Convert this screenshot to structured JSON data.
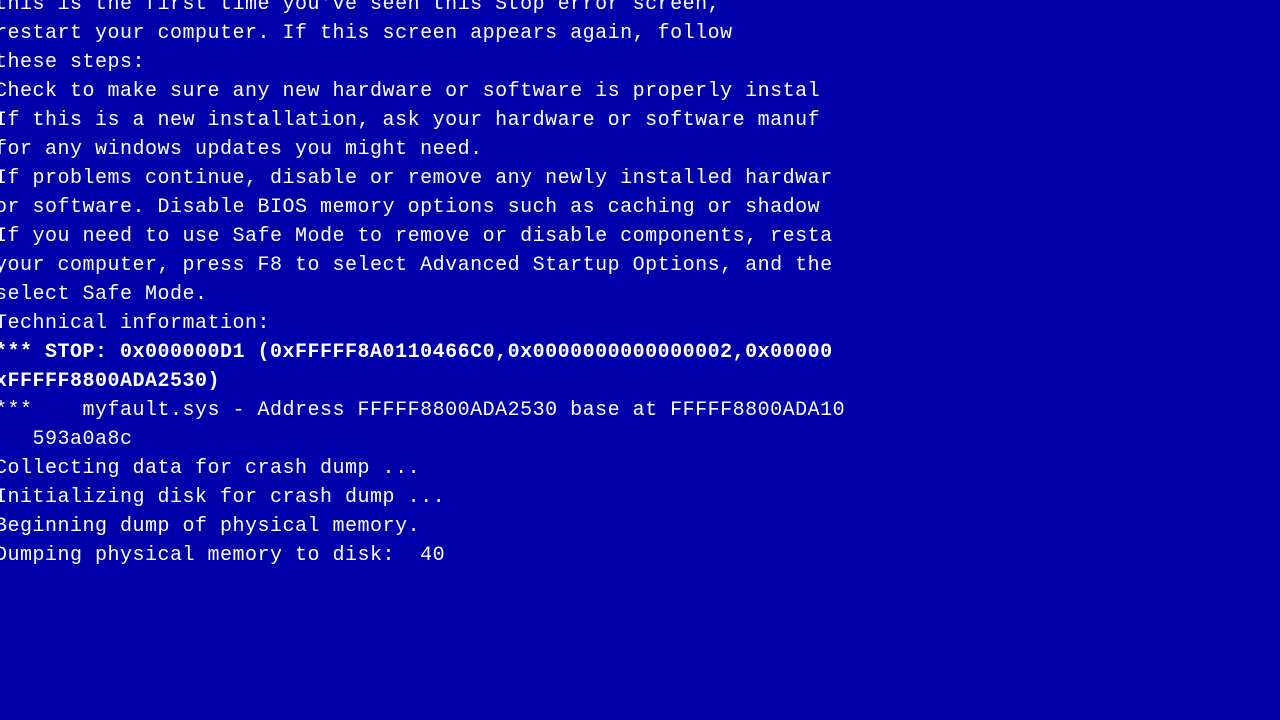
{
  "bsod": {
    "lines": [
      {
        "text": "",
        "bold": false
      },
      {
        "text": "this is the first time you've seen this Stop error screen,",
        "bold": false
      },
      {
        "text": "restart your computer. If this screen appears again, follow",
        "bold": false
      },
      {
        "text": "these steps:",
        "bold": false
      },
      {
        "text": "",
        "bold": false
      },
      {
        "text": "Check to make sure any new hardware or software is properly instal",
        "bold": false
      },
      {
        "text": "If this is a new installation, ask your hardware or software manuf",
        "bold": false
      },
      {
        "text": "for any windows updates you might need.",
        "bold": false
      },
      {
        "text": "",
        "bold": false
      },
      {
        "text": "If problems continue, disable or remove any newly installed hardwar",
        "bold": false
      },
      {
        "text": "or software. Disable BIOS memory options such as caching or shadow",
        "bold": false
      },
      {
        "text": "If you need to use Safe Mode to remove or disable components, resta",
        "bold": false
      },
      {
        "text": "your computer, press F8 to select Advanced Startup Options, and the",
        "bold": false
      },
      {
        "text": "select Safe Mode.",
        "bold": false
      },
      {
        "text": "",
        "bold": false
      },
      {
        "text": "Technical information:",
        "bold": false
      },
      {
        "text": "",
        "bold": false
      },
      {
        "text": "*** STOP: 0x000000D1 (0xFFFFF8A0110466C0,0x0000000000000002,0x00000",
        "bold": true
      },
      {
        "text": "xFFFFF8800ADA2530)",
        "bold": true
      },
      {
        "text": "",
        "bold": false
      },
      {
        "text": "",
        "bold": false
      },
      {
        "text": "***    myfault.sys - Address FFFFF8800ADA2530 base at FFFFF8800ADA10",
        "bold": false
      },
      {
        "text": "   593a0a8c",
        "bold": false
      },
      {
        "text": "",
        "bold": false
      },
      {
        "text": "",
        "bold": false
      },
      {
        "text": "Collecting data for crash dump ...",
        "bold": false
      },
      {
        "text": "Initializing disk for crash dump ...",
        "bold": false
      },
      {
        "text": "Beginning dump of physical memory.",
        "bold": false
      },
      {
        "text": "Dumping physical memory to disk:  40",
        "bold": false
      }
    ]
  }
}
